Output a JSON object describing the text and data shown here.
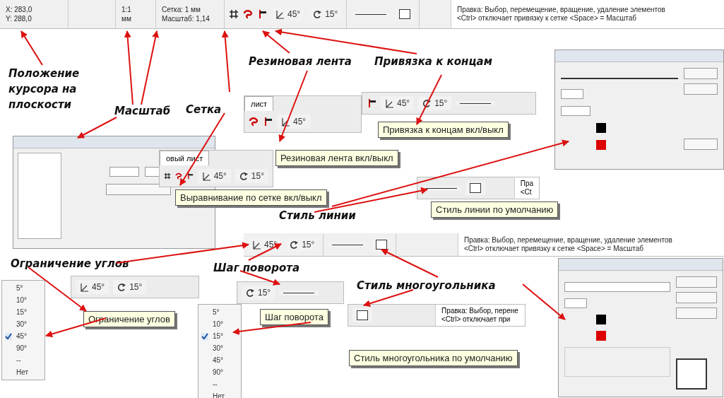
{
  "status_bar": {
    "cursor_x": "X: 283,0",
    "cursor_y": "Y: 288,0",
    "scale": "1:1",
    "units": "мм",
    "grid": "Сетка: 1 мм",
    "zoom": "Масштаб:  1,14",
    "angle": "45°",
    "rotation": "15°",
    "hint": "Правка: Выбор, перемещение, вращение, удаление элементов",
    "hint_2": "<Ctrl> отключает привязку к сетке <Space> = Масштаб"
  },
  "callouts": [
    "Положение курсора на плоскости",
    "Масштаб",
    "Сетка",
    "Резиновая лента",
    "Привязка к концам",
    "Стиль линии",
    "Ограничение углов",
    "Шаг поворота",
    "Стиль многоугольника"
  ],
  "grid_fragment": {
    "tab": "овый лист",
    "angle": "45°",
    "rotation": "15°",
    "tooltip": "Выравнивание по сетке вкл/выкл"
  },
  "rubber_band_fragment": {
    "tab": "лист",
    "angle": "45°",
    "tooltip": "Резиновая лента вкл/выкл"
  },
  "snap_fragment": {
    "angle": "45°",
    "rotation": "15°",
    "tooltip": "Привязка к концам вкл/выкл"
  },
  "line_style_fragment": {
    "hint": "Пра",
    "hint_2": "<Ct",
    "tooltip": "Стиль линии по умолчанию"
  },
  "status_bar_2": {
    "angle": "45°",
    "rotation": "15°",
    "hint": "Правка: Выбор, перемещение, вращение, удаление элементов",
    "hint_2": "<Ctrl> отключает привязку к сетке <Space> = Масштаб"
  },
  "angle_menu": {
    "items": [
      {
        "label": "5°",
        "checked": false
      },
      {
        "label": "10°",
        "checked": false
      },
      {
        "label": "15°",
        "checked": false
      },
      {
        "label": "30°",
        "checked": false
      },
      {
        "label": "45°",
        "checked": true
      },
      {
        "label": "90°",
        "checked": false
      },
      {
        "label": "--",
        "checked": false
      },
      {
        "label": "Нет",
        "checked": false
      }
    ]
  },
  "angle_fragment": {
    "angle": "45°",
    "rotation": "15°",
    "tooltip": "Ограничение углов"
  },
  "rotation_fragment": {
    "rotation": "15°",
    "tooltip": "Шаг поворота"
  },
  "rotation_menu": {
    "items": [
      {
        "label": "5°",
        "checked": false
      },
      {
        "label": "10°",
        "checked": false
      },
      {
        "label": "15°",
        "checked": true
      },
      {
        "label": "30°",
        "checked": false
      },
      {
        "label": "45°",
        "checked": false
      },
      {
        "label": "90°",
        "checked": false
      },
      {
        "label": "--",
        "checked": false
      },
      {
        "label": "Нет",
        "checked": false
      }
    ]
  },
  "polygon_fragment": {
    "hint": "Правка: Выбор, перене",
    "hint_2": "<Ctrl> отключает при",
    "tooltip": "Стиль многоугольника по умолчанию"
  }
}
